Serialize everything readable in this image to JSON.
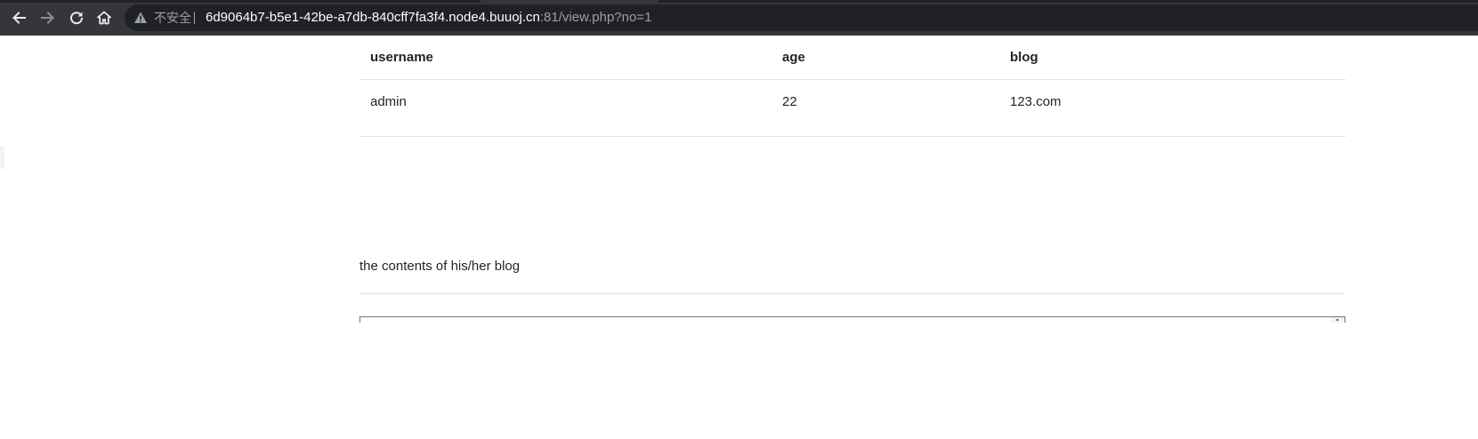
{
  "browser": {
    "security_label": "不安全",
    "url_host": "6d9064b7-b5e1-42be-a7db-840cff7fa3f4.node4.buuoj.cn",
    "url_rest": ":81/view.php?no=1",
    "icons": [
      "back-icon",
      "forward-icon",
      "reload-icon",
      "home-icon",
      "warning-icon"
    ]
  },
  "table": {
    "headers": {
      "username": "username",
      "age": "age",
      "blog": "blog"
    },
    "row": {
      "username": "admin",
      "age": "22",
      "blog": "123.com"
    }
  },
  "blog_section": {
    "heading": "the contents of his/her blog"
  }
}
